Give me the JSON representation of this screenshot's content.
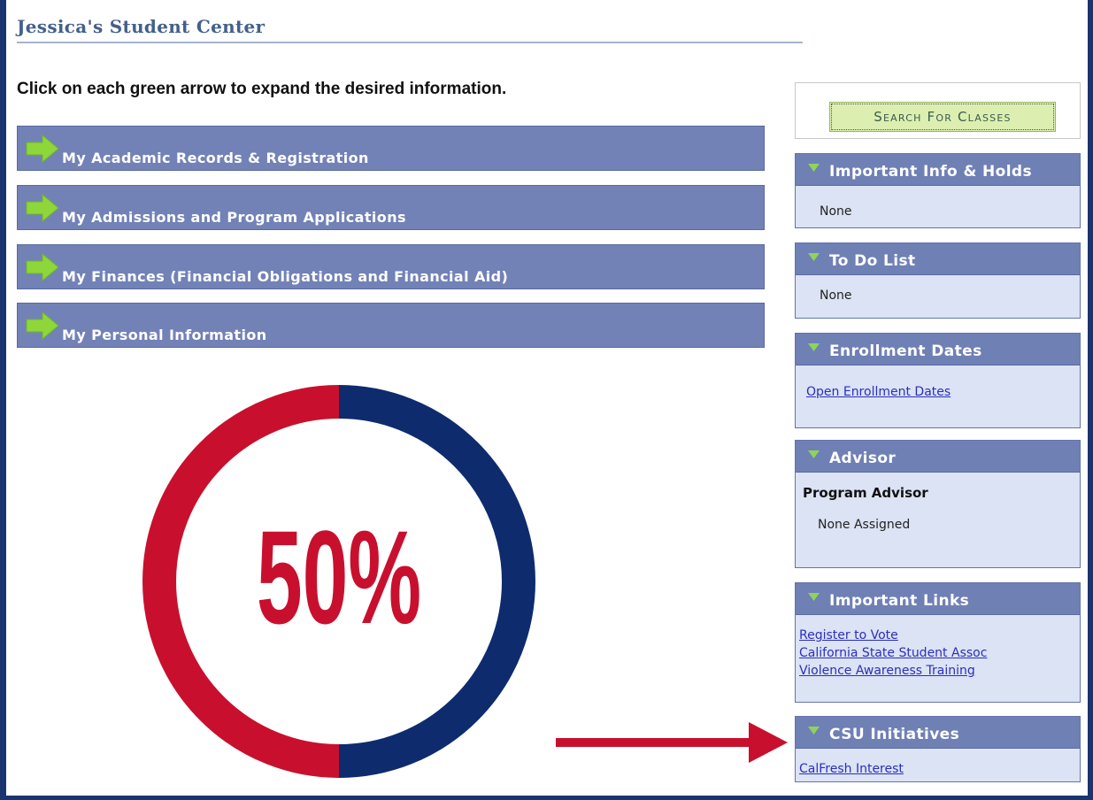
{
  "header": {
    "title": "Jessica's Student Center",
    "instructions": "Click on each green arrow to expand the desired information."
  },
  "sections": [
    {
      "label": "My Academic Records & Registration"
    },
    {
      "label": "My Admissions and Program Applications"
    },
    {
      "label": "My Finances (Financial Obligations and Financial Aid)"
    },
    {
      "label": "My Personal Information"
    }
  ],
  "graphic": {
    "percent_label": "50%",
    "progress_fraction": 0.5,
    "colors": {
      "red": "#c8102e",
      "blue": "#0e2b6e"
    }
  },
  "sidebar": {
    "search_button": "Search For Classes",
    "important_info": {
      "title": "Important Info & Holds",
      "text": "None"
    },
    "todo": {
      "title": "To Do List",
      "text": "None"
    },
    "enrollment": {
      "title": "Enrollment Dates",
      "link": "Open Enrollment Dates"
    },
    "advisor": {
      "title": "Advisor",
      "role": "Program Advisor",
      "value": "None Assigned"
    },
    "links": {
      "title": "Important Links",
      "items": [
        "Register to Vote",
        "California State Student Assoc",
        "Violence Awareness Training"
      ]
    },
    "csu": {
      "title": "CSU Initiatives",
      "link": "CalFresh Interest"
    }
  },
  "icons": {
    "section_arrow": "green-arrow-icon",
    "panel_toggle": "triangle-down-icon"
  }
}
